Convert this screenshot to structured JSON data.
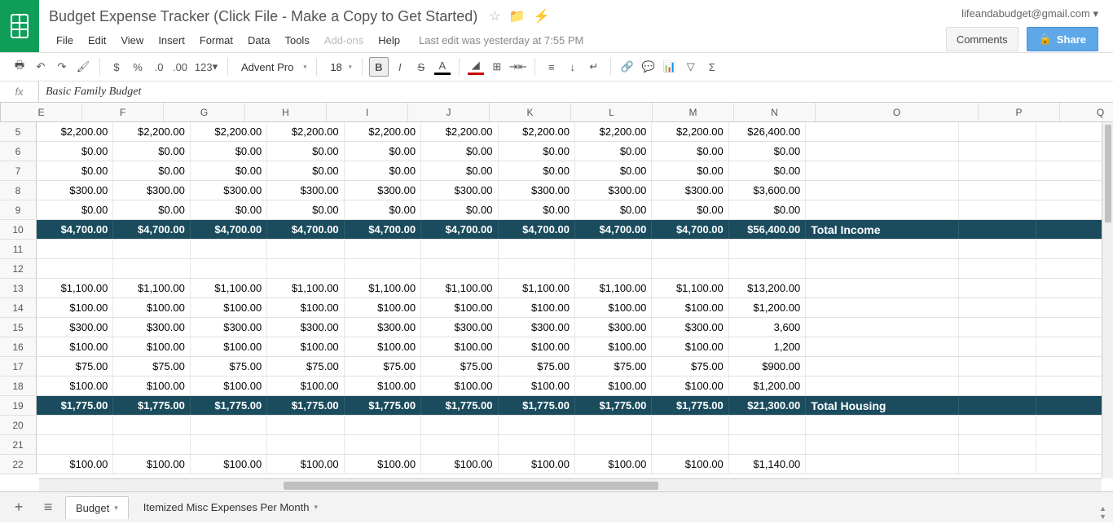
{
  "doc_title": "Budget Expense Tracker (Click File - Make a Copy to Get Started)",
  "user_email": "lifeandabudget@gmail.com",
  "comments_label": "Comments",
  "share_label": "Share",
  "edit_info": "Last edit was yesterday at 7:55 PM",
  "menu": {
    "file": "File",
    "edit": "Edit",
    "view": "View",
    "insert": "Insert",
    "format": "Format",
    "data": "Data",
    "tools": "Tools",
    "addons": "Add-ons",
    "help": "Help"
  },
  "toolbar": {
    "currency": "$",
    "percent": "%",
    "dec_dec": ".0",
    "dec_inc": ".00",
    "num_fmt": "123",
    "font": "Advent Pro",
    "size": "18"
  },
  "formula": "Basic Family Budget",
  "columns": [
    "E",
    "F",
    "G",
    "H",
    "I",
    "J",
    "K",
    "L",
    "M",
    "N",
    "O",
    "P",
    "Q"
  ],
  "rows": [
    {
      "n": "5",
      "cells": [
        "$2,200.00",
        "$2,200.00",
        "$2,200.00",
        "$2,200.00",
        "$2,200.00",
        "$2,200.00",
        "$2,200.00",
        "$2,200.00",
        "$2,200.00",
        "$26,400.00",
        "",
        "",
        ""
      ]
    },
    {
      "n": "6",
      "cells": [
        "$0.00",
        "$0.00",
        "$0.00",
        "$0.00",
        "$0.00",
        "$0.00",
        "$0.00",
        "$0.00",
        "$0.00",
        "$0.00",
        "",
        "",
        ""
      ]
    },
    {
      "n": "7",
      "cells": [
        "$0.00",
        "$0.00",
        "$0.00",
        "$0.00",
        "$0.00",
        "$0.00",
        "$0.00",
        "$0.00",
        "$0.00",
        "$0.00",
        "",
        "",
        ""
      ]
    },
    {
      "n": "8",
      "cells": [
        "$300.00",
        "$300.00",
        "$300.00",
        "$300.00",
        "$300.00",
        "$300.00",
        "$300.00",
        "$300.00",
        "$300.00",
        "$3,600.00",
        "",
        "",
        ""
      ]
    },
    {
      "n": "9",
      "cells": [
        "$0.00",
        "$0.00",
        "$0.00",
        "$0.00",
        "$0.00",
        "$0.00",
        "$0.00",
        "$0.00",
        "$0.00",
        "$0.00",
        "",
        "",
        ""
      ]
    },
    {
      "n": "10",
      "total": true,
      "cells": [
        "$4,700.00",
        "$4,700.00",
        "$4,700.00",
        "$4,700.00",
        "$4,700.00",
        "$4,700.00",
        "$4,700.00",
        "$4,700.00",
        "$4,700.00",
        "$56,400.00",
        "Total Income",
        "",
        ""
      ]
    },
    {
      "n": "11",
      "cells": [
        "",
        "",
        "",
        "",
        "",
        "",
        "",
        "",
        "",
        "",
        "",
        "",
        ""
      ]
    },
    {
      "n": "12",
      "cells": [
        "",
        "",
        "",
        "",
        "",
        "",
        "",
        "",
        "",
        "",
        "",
        "",
        ""
      ]
    },
    {
      "n": "13",
      "cells": [
        "$1,100.00",
        "$1,100.00",
        "$1,100.00",
        "$1,100.00",
        "$1,100.00",
        "$1,100.00",
        "$1,100.00",
        "$1,100.00",
        "$1,100.00",
        "$13,200.00",
        "",
        "",
        ""
      ]
    },
    {
      "n": "14",
      "cells": [
        "$100.00",
        "$100.00",
        "$100.00",
        "$100.00",
        "$100.00",
        "$100.00",
        "$100.00",
        "$100.00",
        "$100.00",
        "$1,200.00",
        "",
        "",
        ""
      ]
    },
    {
      "n": "15",
      "cells": [
        "$300.00",
        "$300.00",
        "$300.00",
        "$300.00",
        "$300.00",
        "$300.00",
        "$300.00",
        "$300.00",
        "$300.00",
        "3,600",
        "",
        "",
        ""
      ]
    },
    {
      "n": "16",
      "cells": [
        "$100.00",
        "$100.00",
        "$100.00",
        "$100.00",
        "$100.00",
        "$100.00",
        "$100.00",
        "$100.00",
        "$100.00",
        "1,200",
        "",
        "",
        ""
      ]
    },
    {
      "n": "17",
      "cells": [
        "$75.00",
        "$75.00",
        "$75.00",
        "$75.00",
        "$75.00",
        "$75.00",
        "$75.00",
        "$75.00",
        "$75.00",
        "$900.00",
        "",
        "",
        ""
      ]
    },
    {
      "n": "18",
      "cells": [
        "$100.00",
        "$100.00",
        "$100.00",
        "$100.00",
        "$100.00",
        "$100.00",
        "$100.00",
        "$100.00",
        "$100.00",
        "$1,200.00",
        "",
        "",
        ""
      ]
    },
    {
      "n": "19",
      "total": true,
      "cells": [
        "$1,775.00",
        "$1,775.00",
        "$1,775.00",
        "$1,775.00",
        "$1,775.00",
        "$1,775.00",
        "$1,775.00",
        "$1,775.00",
        "$1,775.00",
        "$21,300.00",
        "Total Housing",
        "",
        ""
      ]
    },
    {
      "n": "20",
      "cells": [
        "",
        "",
        "",
        "",
        "",
        "",
        "",
        "",
        "",
        "",
        "",
        "",
        ""
      ]
    },
    {
      "n": "21",
      "cells": [
        "",
        "",
        "",
        "",
        "",
        "",
        "",
        "",
        "",
        "",
        "",
        "",
        ""
      ]
    },
    {
      "n": "22",
      "cells": [
        "$100.00",
        "$100.00",
        "$100.00",
        "$100.00",
        "$100.00",
        "$100.00",
        "$100.00",
        "$100.00",
        "$100.00",
        "$1,140.00",
        "",
        "",
        ""
      ]
    }
  ],
  "tabs": {
    "active": "Budget",
    "other": "Itemized Misc Expenses Per Month"
  }
}
